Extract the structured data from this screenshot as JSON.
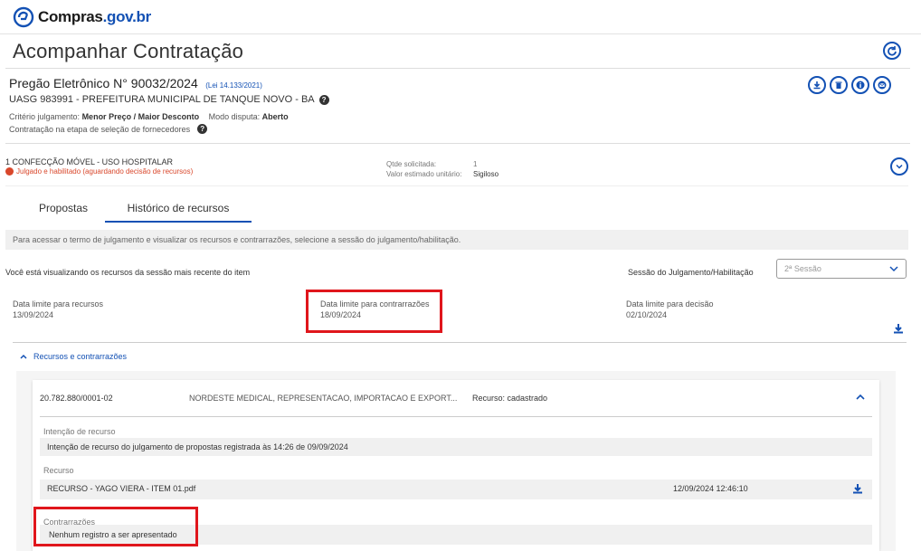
{
  "header": {
    "logo_text": "Compras",
    "logo_domain": ".gov.br"
  },
  "page": {
    "title": "Acompanhar Contratação"
  },
  "pregao": {
    "title": "Pregão Eletrônico N° 90032/2024",
    "law": "(Lei 14.133/2021)",
    "uasg": "UASG 983991 - PREFEITURA MUNICIPAL DE TANQUE NOVO - BA",
    "criterio_label": "Critério julgamento:",
    "criterio_value": "Menor Preço / Maior Desconto",
    "modo_label": "Modo disputa:",
    "modo_value": "Aberto",
    "etapa": "Contratação na etapa de seleção de fornecedores"
  },
  "item": {
    "title": "1  CONFECÇÃO MÓVEL - USO HOSPITALAR",
    "status": "Julgado e habilitado (aguardando decisão de recursos)",
    "qtde_label": "Qtde solicitada:",
    "qtde_value": "1",
    "valor_label": "Valor estimado unitário:",
    "valor_value": "Sigiloso"
  },
  "tabs": [
    {
      "label": "Propostas"
    },
    {
      "label": "Histórico de recursos"
    }
  ],
  "info_text": "Para acessar o termo de julgamento e visualizar os recursos e contrarrazões, selecione a sessão do julgamento/habilitação.",
  "session": {
    "viewing_text": "Você está visualizando os recursos da sessão mais recente do item",
    "select_label": "Sessão do Julgamento/Habilitação",
    "select_value": "2ª Sessão"
  },
  "dates": {
    "recursos_label": "Data limite para recursos",
    "recursos_value": "13/09/2024",
    "contrarrazoes_label": "Data limite para contrarrazões",
    "contrarrazoes_value": "18/09/2024",
    "decisao_label": "Data limite para decisão",
    "decisao_value": "02/10/2024"
  },
  "recursos": {
    "section_label": "Recursos e contrarrazões",
    "cnpj": "20.782.880/0001-02",
    "empresa": "NORDESTE MEDICAL, REPRESENTACAO, IMPORTACAO E EXPORT...",
    "status": "Recurso: cadastrado",
    "intencao_label": "Intenção de recurso",
    "intencao_text": "Intenção de recurso do julgamento de propostas registrada às 14:26 de 09/09/2024",
    "recurso_label": "Recurso",
    "recurso_file": "RECURSO - YAGO VIERA - ITEM 01.pdf",
    "recurso_datetime": "12/09/2024 12:46:10",
    "contrarrazoes_label": "Contrarrazões",
    "contrarrazoes_text": "Nenhum registro a ser apresentado"
  },
  "colors": {
    "accent": "#1351b4",
    "highlight": "#e0161c",
    "status": "#d9472b"
  }
}
